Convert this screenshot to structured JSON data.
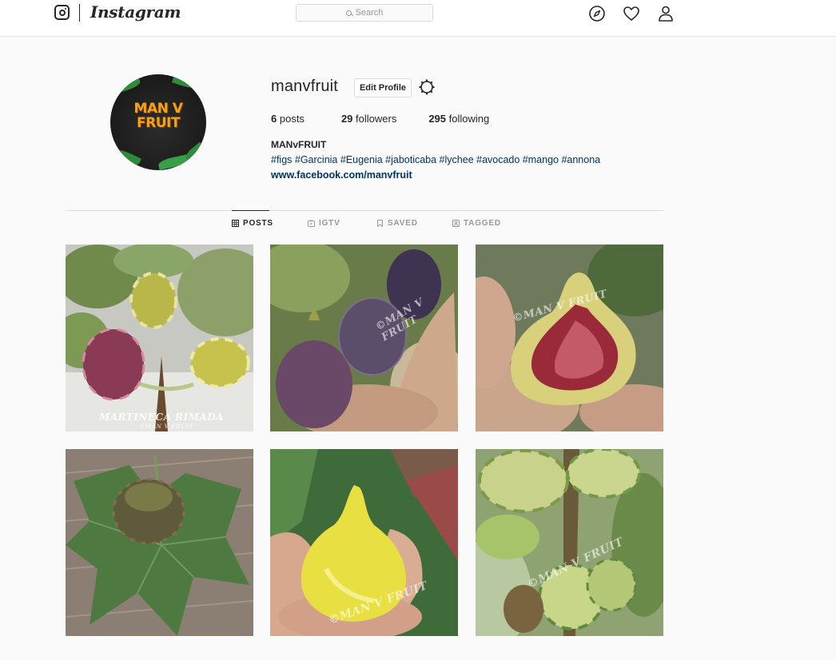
{
  "header": {
    "brand": "Instagram",
    "search_placeholder": "Search",
    "icons": [
      "instagram-icon",
      "explore-icon",
      "heart-icon",
      "profile-icon"
    ]
  },
  "profile": {
    "username": "manvfruit",
    "edit_label": "Edit Profile",
    "avatar_text": [
      "MAN V",
      "FRUIT"
    ],
    "stats": {
      "posts_count": "6",
      "posts_label": "posts",
      "followers_count": "29",
      "followers_label": "followers",
      "following_count": "295",
      "following_label": "following"
    },
    "full_name": "MANvFRUIT",
    "bio": "#figs #Garcinia #Eugenia #jaboticaba #lychee #avocado #mango #annona",
    "website": "www.facebook.com/manvfruit"
  },
  "tabs": [
    {
      "label": "POSTS",
      "active": true
    },
    {
      "label": "IGTV",
      "active": false
    },
    {
      "label": "SAVED",
      "active": false
    },
    {
      "label": "TAGGED",
      "active": false
    }
  ],
  "posts": [
    {
      "watermark": "MARTINECA RIMADA",
      "subtext": "©MAN V FRUIT"
    },
    {
      "watermark": "©MAN V FRUIT"
    },
    {
      "watermark": "©MAN V FRUIT"
    },
    {
      "watermark": ""
    },
    {
      "watermark": "©MAN V FRUIT"
    },
    {
      "watermark": "©MAN V FRUIT"
    }
  ],
  "colors": {
    "accent_link": "#003569",
    "border": "#dbdbdb",
    "background": "#fafafa",
    "avatar_logo": "#f5a315"
  }
}
